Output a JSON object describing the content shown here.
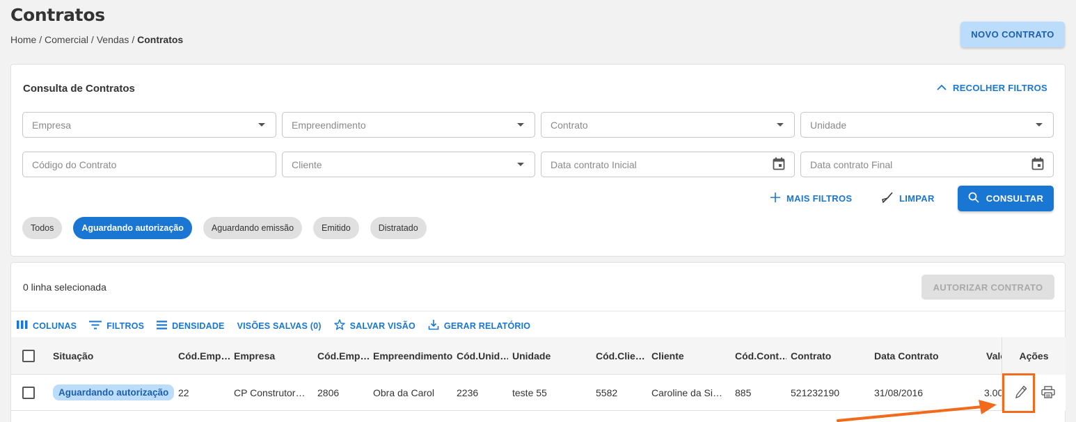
{
  "page": {
    "title": "Contratos",
    "breadcrumb": [
      "Home",
      "Comercial",
      "Vendas",
      "Contratos"
    ],
    "breadcrumb_sep": " / ",
    "new_button": "NOVO CONTRATO"
  },
  "filters": {
    "title": "Consulta de Contratos",
    "collapse_label": "RECOLHER FILTROS",
    "fields": {
      "empresa": "Empresa",
      "empreendimento": "Empreendimento",
      "contrato": "Contrato",
      "unidade": "Unidade",
      "codigo_contrato": "Código do Contrato",
      "cliente": "Cliente",
      "data_inicial": "Data contrato Inicial",
      "data_final": "Data contrato Final"
    },
    "more_filters": "MAIS FILTROS",
    "clear": "LIMPAR",
    "search": "CONSULTAR",
    "chips": [
      {
        "label": "Todos",
        "active": false
      },
      {
        "label": "Aguardando autorização",
        "active": true
      },
      {
        "label": "Aguardando emissão",
        "active": false
      },
      {
        "label": "Emitido",
        "active": false
      },
      {
        "label": "Distratado",
        "active": false
      }
    ]
  },
  "grid": {
    "selection_info": "0 linha selecionada",
    "authorize_button": "AUTORIZAR CONTRATO",
    "toolbar": {
      "columns": "COLUNAS",
      "filters": "FILTROS",
      "density": "DENSIDADE",
      "saved_views": "VISÕES SALVAS (0)",
      "save_view": "SALVAR VISÃO",
      "report": "GERAR RELATÓRIO"
    },
    "headers": {
      "situacao": "Situação",
      "cod_empresa": "Cód.Emp…",
      "empresa": "Empresa",
      "cod_empreendimento": "Cód.Emp…",
      "empreendimento": "Empreendimento",
      "cod_unidade": "Cód.Unid…",
      "unidade": "Unidade",
      "cod_cliente": "Cód.Clie…",
      "cliente": "Cliente",
      "cod_contrato": "Cód.Cont…",
      "contrato": "Contrato",
      "data_contrato": "Data Contrato",
      "valor": "Valo",
      "acoes": "Ações"
    },
    "rows": [
      {
        "situacao": "Aguardando autorização",
        "cod_empresa": "22",
        "empresa": "CP Construtor…",
        "cod_empreendimento": "2806",
        "empreendimento": "Obra da Carol",
        "cod_unidade": "2236",
        "unidade": "teste 55",
        "cod_cliente": "5582",
        "cliente": "Caroline da Si…",
        "cod_contrato": "885",
        "contrato": "521232190",
        "data_contrato": "31/08/2016",
        "valor": "3.00"
      }
    ]
  },
  "colors": {
    "primary": "#1976d2",
    "badge_bg": "#bcdcfb",
    "annotation": "#f26a1b"
  }
}
